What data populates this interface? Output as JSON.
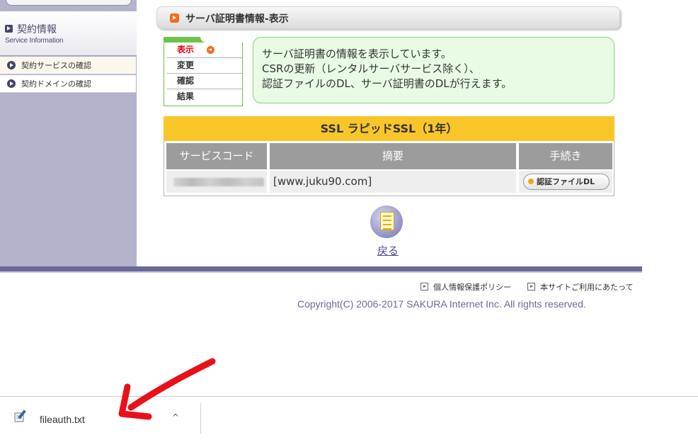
{
  "sidebar": {
    "section_title": "契約情報",
    "section_subtitle": "Service Information",
    "items": [
      {
        "label": "契約サービスの確認"
      },
      {
        "label": "契約ドメインの確認"
      }
    ]
  },
  "main": {
    "page_title": "サーバ証明書情報-表示",
    "steps": [
      {
        "label": "表示",
        "active": true
      },
      {
        "label": "変更"
      },
      {
        "label": "確認"
      },
      {
        "label": "結果"
      }
    ],
    "info_lines": [
      "サーバ証明書の情報を表示しています。",
      "CSRの更新（レンタルサーバサービス除く）、",
      "認証ファイルのDL、サーバ証明書のDLが行えます。"
    ],
    "ssl_table": {
      "title": "SSL ラピッドSSL（1年）",
      "headers": [
        "サービスコード",
        "摘要",
        "手続き"
      ],
      "row": {
        "service_code": "",
        "summary": "[www.juku90.com]",
        "action_label": "認証ファイルDL"
      }
    },
    "back_label": "戻る"
  },
  "footer": {
    "links": [
      {
        "label": "個人情報保護ポリシー"
      },
      {
        "label": "本サイトご利用にあたって"
      }
    ],
    "copyright": "Copyright(C) 2006-2017 SAKURA Internet Inc. All rights reserved."
  },
  "download_bar": {
    "file_name": "fileauth.txt",
    "chevron": "^"
  },
  "colors": {
    "sidebar_bg": "#b3b3cc",
    "accent_orange": "#f26c1c",
    "table_header_yellow": "#f9c62a",
    "info_box_bg": "#e9fbe5",
    "step_green": "#6cc24a",
    "annotation_red": "#e8101a"
  },
  "icons": {
    "title": "arrow-square-icon",
    "back": "document-icon",
    "file": "text-file-icon"
  }
}
